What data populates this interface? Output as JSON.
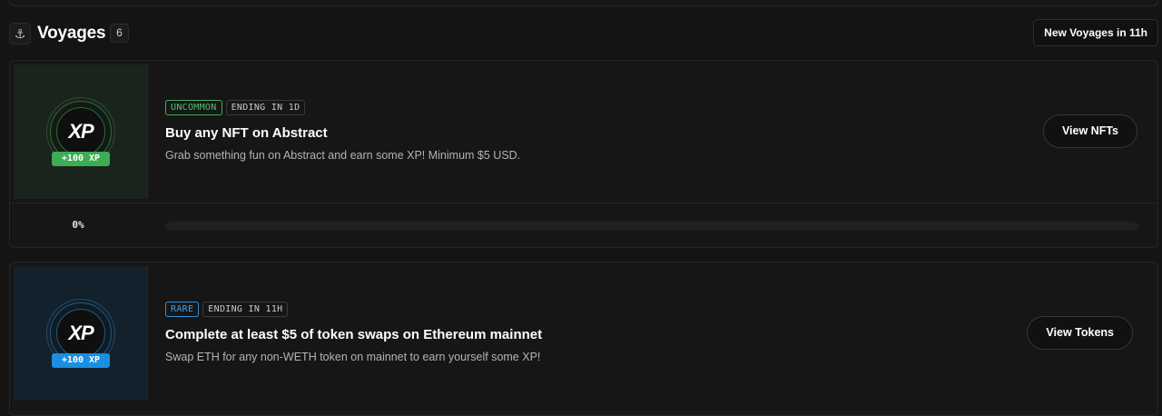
{
  "header": {
    "anchor_icon": "⚓",
    "title": "Voyages",
    "count": "6",
    "new_voyages_label": "New Voyages in 11h"
  },
  "voyages": [
    {
      "theme_color": "#3cac55",
      "icon": "xp-badge-icon",
      "xp_logo": "XP",
      "reward": "+100 XP",
      "rarity": "UNCOMMON",
      "ending": "ENDING IN 1D",
      "title": "Buy any NFT on Abstract",
      "description": "Grab something fun on Abstract and earn some XP! Minimum $5 USD.",
      "cta": "View NFTs",
      "progress_label": "0%",
      "progress_fraction": 0
    },
    {
      "theme_color": "#1a8fe3",
      "icon": "xp-badge-icon",
      "xp_logo": "XP",
      "reward": "+100 XP",
      "rarity": "RARE",
      "ending": "ENDING IN 11H",
      "title": "Complete at least $5 of token swaps on Ethereum mainnet",
      "description": "Swap ETH for any non-WETH token on mainnet to earn yourself some XP!",
      "cta": "View Tokens"
    }
  ]
}
